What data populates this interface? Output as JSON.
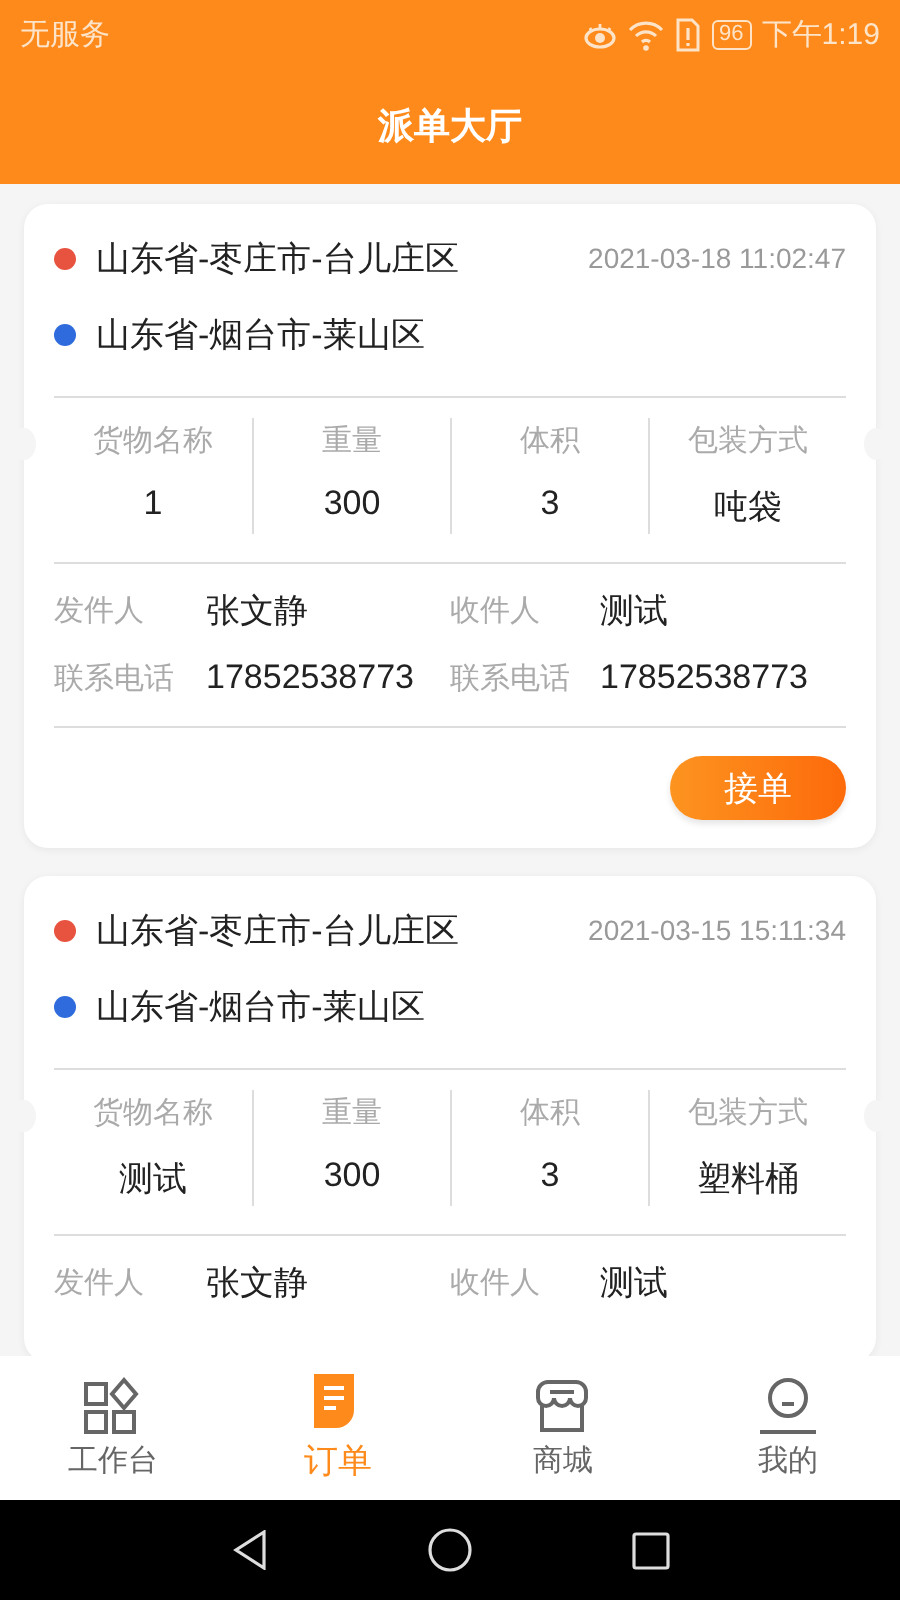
{
  "status_bar": {
    "carrier": "无服务",
    "battery": "96",
    "time": "下午1:19"
  },
  "header": {
    "title": "派单大厅"
  },
  "orders": [
    {
      "addresses": [
        {
          "text": "山东省-枣庄市-台儿庄区",
          "color": "#e8533f"
        },
        {
          "text": "山东省-烟台市-莱山区",
          "color": "#2f6bdc"
        }
      ],
      "time": "2021-03-18 11:02:47",
      "goods": [
        {
          "label": "货物名称",
          "value": "1"
        },
        {
          "label": "重量",
          "value": "300"
        },
        {
          "label": "体积",
          "value": "3"
        },
        {
          "label": "包装方式",
          "value": "吨袋"
        }
      ],
      "contacts": [
        {
          "label": "发件人",
          "value": "张文静"
        },
        {
          "label": "收件人",
          "value": "测试"
        },
        {
          "label": "联系电话",
          "value": "17852538773"
        },
        {
          "label": "联系电话",
          "value": "17852538773"
        }
      ],
      "button": "接单"
    },
    {
      "addresses": [
        {
          "text": "山东省-枣庄市-台儿庄区",
          "color": "#e8533f"
        },
        {
          "text": "山东省-烟台市-莱山区",
          "color": "#2f6bdc"
        }
      ],
      "time": "2021-03-15 15:11:34",
      "goods": [
        {
          "label": "货物名称",
          "value": "测试"
        },
        {
          "label": "重量",
          "value": "300"
        },
        {
          "label": "体积",
          "value": "3"
        },
        {
          "label": "包装方式",
          "value": "塑料桶"
        }
      ],
      "contacts": [
        {
          "label": "发件人",
          "value": "张文静"
        },
        {
          "label": "收件人",
          "value": "测试"
        }
      ]
    }
  ],
  "tabs": [
    {
      "label": "工作台",
      "kind": "grid",
      "selected": false
    },
    {
      "label": "订单",
      "kind": "document",
      "selected": true
    },
    {
      "label": "商城",
      "kind": "store",
      "selected": false
    },
    {
      "label": "我的",
      "kind": "person",
      "selected": false
    }
  ]
}
